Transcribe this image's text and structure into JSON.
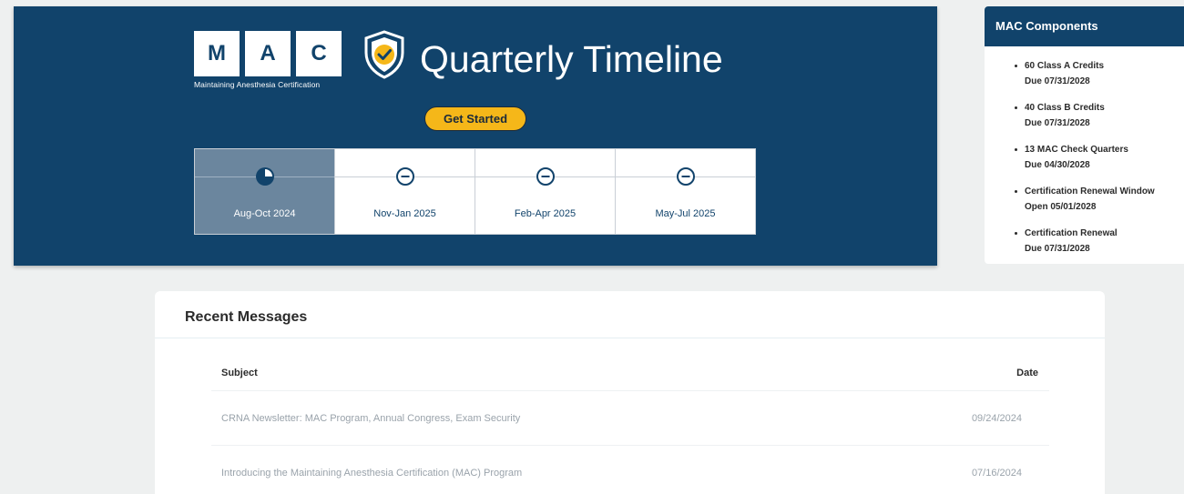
{
  "hero": {
    "logo_letters": [
      "M",
      "A",
      "C"
    ],
    "logo_subtitle": "Maintaining Anesthesia Certification",
    "title": "Quarterly Timeline",
    "get_started_label": "Get Started",
    "quarters": [
      {
        "label": "Aug-Oct 2024",
        "status": "in-progress",
        "progress": 0.25,
        "icon": "progress-pie-icon"
      },
      {
        "label": "Nov-Jan 2025",
        "status": "not-started",
        "icon": "minus-circle-icon"
      },
      {
        "label": "Feb-Apr 2025",
        "status": "not-started",
        "icon": "minus-circle-icon"
      },
      {
        "label": "May-Jul 2025",
        "status": "not-started",
        "icon": "minus-circle-icon"
      }
    ]
  },
  "components": {
    "title": "MAC Components",
    "items": [
      {
        "name": "60 Class A Credits",
        "detail": "Due 07/31/2028"
      },
      {
        "name": "40 Class B Credits",
        "detail": "Due 07/31/2028"
      },
      {
        "name": "13 MAC Check Quarters",
        "detail": "Due 04/30/2028"
      },
      {
        "name": "Certification Renewal Window",
        "detail": "Open 05/01/2028"
      },
      {
        "name": "Certification Renewal",
        "detail": "Due 07/31/2028"
      }
    ]
  },
  "messages": {
    "title": "Recent Messages",
    "columns": {
      "subject": "Subject",
      "date": "Date"
    },
    "rows": [
      {
        "subject": "CRNA Newsletter: MAC Program, Annual Congress, Exam Security",
        "date": "09/24/2024"
      },
      {
        "subject": "Introducing the Maintaining Anesthesia Certification (MAC) Program",
        "date": "07/16/2024"
      }
    ]
  },
  "colors": {
    "brand_navy": "#11436b",
    "accent_yellow": "#f5b719",
    "active_quarter": "#6b869e"
  }
}
